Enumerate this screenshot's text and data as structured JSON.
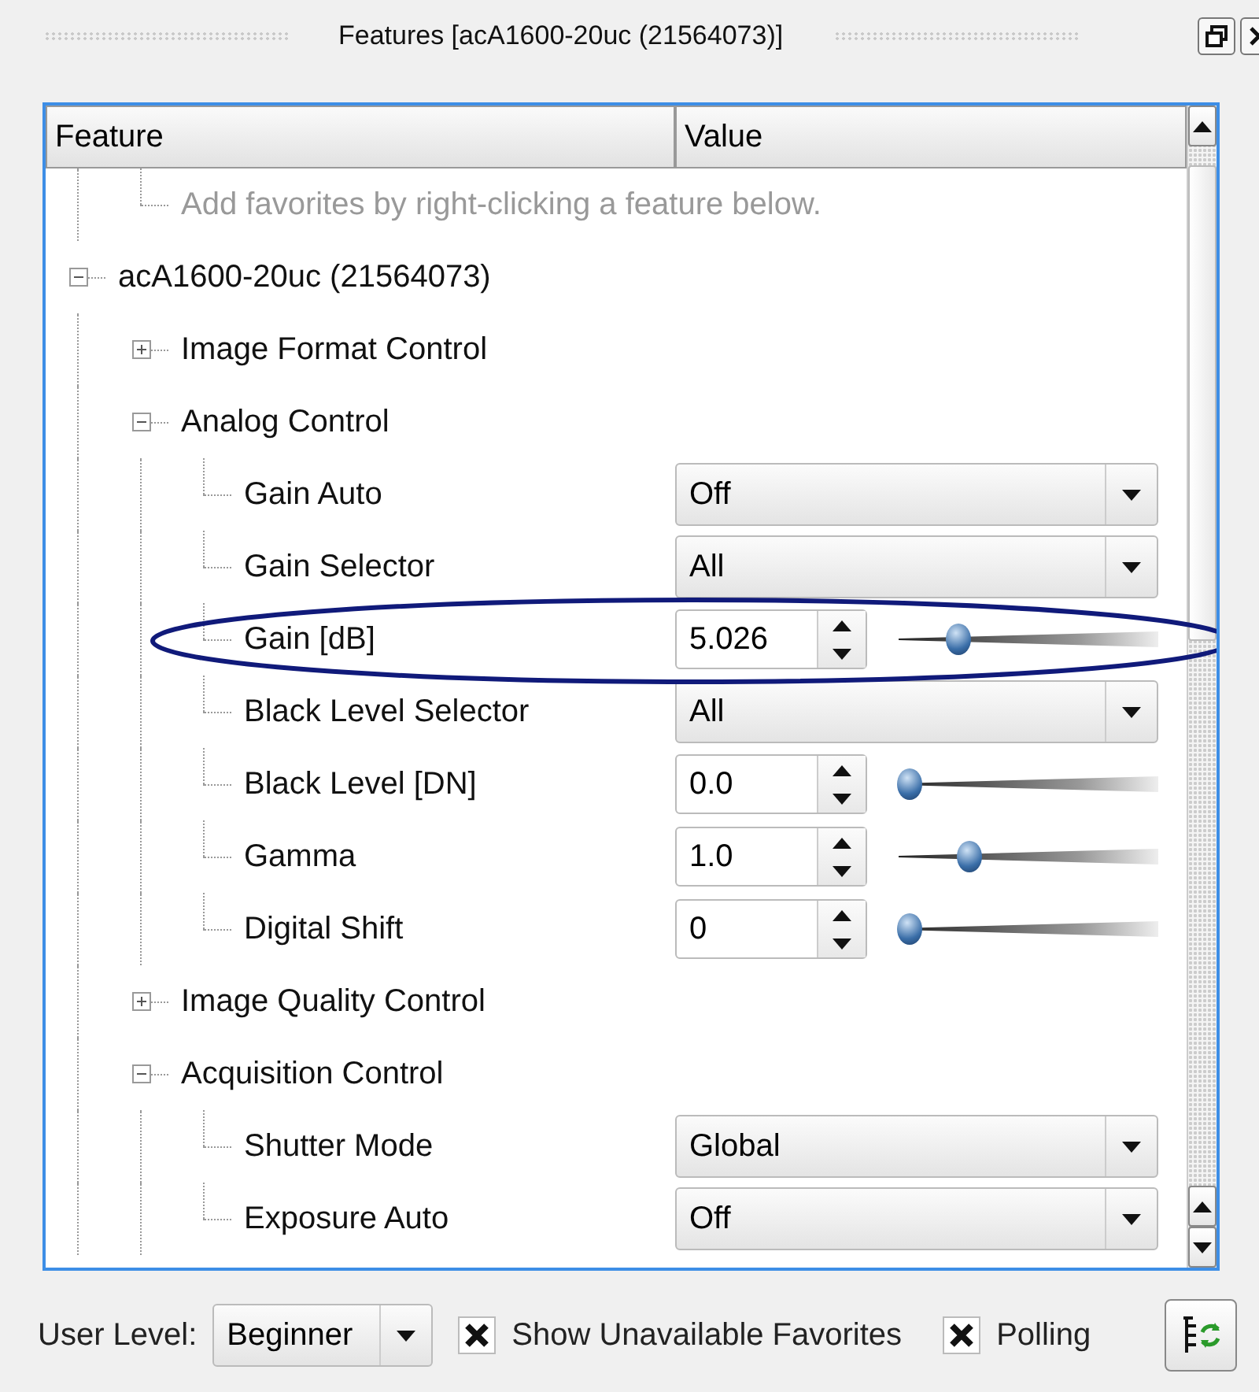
{
  "title": "Features [acA1600-20uc (21564073)]",
  "columns": [
    "Feature",
    "Value"
  ],
  "tree": [
    {
      "kind": "hint",
      "label": "Add favorites by right-clicking a feature below."
    },
    {
      "kind": "category",
      "label": "acA1600-20uc (21564073)",
      "expanded": true,
      "children": [
        {
          "kind": "category",
          "label": "Image Format Control",
          "expanded": false
        },
        {
          "kind": "category",
          "label": "Analog Control",
          "expanded": true,
          "children": [
            {
              "kind": "enum",
              "label": "Gain Auto",
              "value": "Off"
            },
            {
              "kind": "enum",
              "label": "Gain Selector",
              "value": "All"
            },
            {
              "kind": "number",
              "label": "Gain [dB]",
              "value": "5.026",
              "level": 0.23
            },
            {
              "kind": "enum",
              "label": "Black Level Selector",
              "value": "All"
            },
            {
              "kind": "number",
              "label": "Black Level [DN]",
              "value": "0.0",
              "level": 0.04
            },
            {
              "kind": "number",
              "label": "Gamma",
              "value": "1.0",
              "level": 0.27
            },
            {
              "kind": "number",
              "label": "Digital Shift",
              "value": "0",
              "level": 0.04
            }
          ]
        },
        {
          "kind": "category",
          "label": "Image Quality Control",
          "expanded": false
        },
        {
          "kind": "category",
          "label": "Acquisition Control",
          "expanded": true,
          "children": [
            {
              "kind": "enum",
              "label": "Shutter Mode",
              "value": "Global"
            },
            {
              "kind": "enum",
              "label": "Exposure Auto",
              "value": "Off"
            }
          ]
        }
      ]
    }
  ],
  "user_level": {
    "label": "User Level:",
    "value": "Beginner"
  },
  "options": [
    {
      "label": "Show Unavailable Favorites",
      "checked": true
    },
    {
      "label": "Polling",
      "checked": true
    }
  ]
}
